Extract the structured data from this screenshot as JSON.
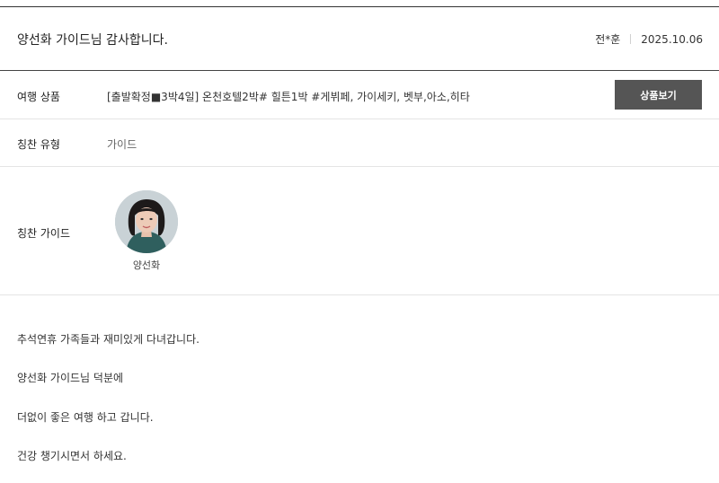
{
  "review": {
    "title": "양선화 가이드님 감사합니다.",
    "author": "전*훈",
    "date": "2025.10.06"
  },
  "rows": {
    "product_label": "여행 상품",
    "product_value": "[출발확정■3박4일] 온천호텔2박# 힐튼1박 #게뷔페, 가이세키, 벳부,아소,히타",
    "product_button": "상품보기",
    "type_label": "칭찬 유형",
    "type_value": "가이드",
    "guide_label": "칭찬 가이드",
    "guide_name": "양선화"
  },
  "content": {
    "lines": [
      "추석연휴 가족들과 재미있게 다녀갑니다.",
      "양선화 가이드님 덕분에",
      "더없이 좋은 여행 하고 갑니다.",
      "건강 챙기시면서 하세요."
    ]
  },
  "colors": {
    "button_bg": "#555555",
    "header_rule": "#333333",
    "divider": "#e4e4e4"
  }
}
